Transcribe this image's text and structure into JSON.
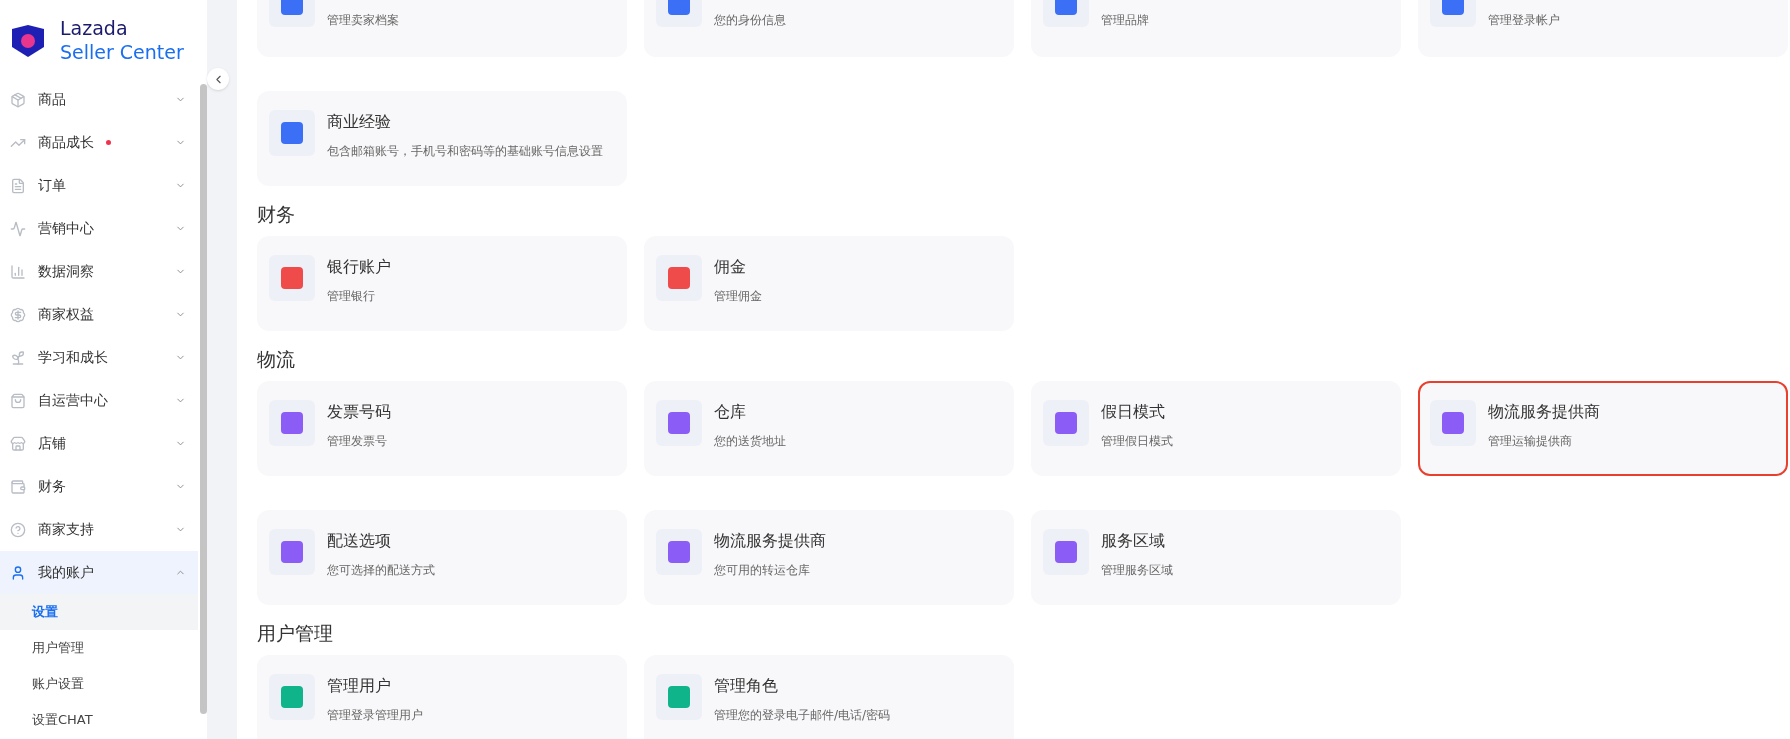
{
  "logo": {
    "line1": "Lazada",
    "line2": "Seller Center"
  },
  "sidebar": {
    "items": [
      {
        "label": "商品",
        "dot": false,
        "expanded": false,
        "selected": false
      },
      {
        "label": "商品成长",
        "dot": true,
        "expanded": false,
        "selected": false
      },
      {
        "label": "订单",
        "dot": false,
        "expanded": false,
        "selected": false
      },
      {
        "label": "营销中心",
        "dot": false,
        "expanded": false,
        "selected": false
      },
      {
        "label": "数据洞察",
        "dot": false,
        "expanded": false,
        "selected": false
      },
      {
        "label": "商家权益",
        "dot": false,
        "expanded": false,
        "selected": false
      },
      {
        "label": "学习和成长",
        "dot": false,
        "expanded": false,
        "selected": false
      },
      {
        "label": "自运营中心",
        "dot": false,
        "expanded": false,
        "selected": false
      },
      {
        "label": "店铺",
        "dot": false,
        "expanded": false,
        "selected": false
      },
      {
        "label": "财务",
        "dot": false,
        "expanded": false,
        "selected": false
      },
      {
        "label": "商家支持",
        "dot": false,
        "expanded": false,
        "selected": false
      },
      {
        "label": "我的账户",
        "dot": false,
        "expanded": true,
        "selected": true,
        "children": [
          {
            "label": "设置",
            "selected": true
          },
          {
            "label": "用户管理",
            "selected": false
          },
          {
            "label": "账户设置",
            "selected": false
          },
          {
            "label": "设置CHAT",
            "selected": false
          }
        ]
      }
    ]
  },
  "sections": [
    {
      "rows": [
        [
          {
            "description": "管理卖家档案",
            "color": "#3b6ff5",
            "highlighted": false
          },
          {
            "description": "您的身份信息",
            "color": "#3b6ff5",
            "highlighted": false
          },
          {
            "description": "管理品牌",
            "color": "#3b6ff5",
            "highlighted": false
          },
          {
            "description": "管理登录帐户",
            "color": "#3b6ff5",
            "highlighted": false
          }
        ],
        [
          {
            "title": "商业经验",
            "description": "包含邮箱账号，手机号和密码等的基础账号信息设置",
            "color": "#3b6ff5",
            "highlighted": false
          }
        ]
      ]
    },
    {
      "title": "财务",
      "rows": [
        [
          {
            "title": "银行账户",
            "description": "管理银行",
            "color": "#f04b4b",
            "highlighted": false
          },
          {
            "title": "佣金",
            "description": "管理佣金",
            "color": "#f04b4b",
            "highlighted": false
          }
        ]
      ]
    },
    {
      "title": "物流",
      "rows": [
        [
          {
            "title": "发票号码",
            "description": "管理发票号",
            "color": "#8b5cf6",
            "highlighted": false
          },
          {
            "title": "仓库",
            "description": "您的送货地址",
            "color": "#8b5cf6",
            "highlighted": false
          },
          {
            "title": "假日模式",
            "description": "管理假日模式",
            "color": "#8b5cf6",
            "highlighted": false
          },
          {
            "title": "物流服务提供商",
            "description": "管理运输提供商",
            "color": "#8b5cf6",
            "highlighted": true
          }
        ],
        [
          {
            "title": "配送选项",
            "description": "您可选择的配送方式",
            "color": "#8b5cf6",
            "highlighted": false
          },
          {
            "title": "物流服务提供商",
            "description": "您可用的转运仓库",
            "color": "#8b5cf6",
            "highlighted": false
          },
          {
            "title": "服务区域",
            "description": "管理服务区域",
            "color": "#8b5cf6",
            "highlighted": false
          }
        ]
      ]
    },
    {
      "title": "用户管理",
      "rows": [
        [
          {
            "title": "管理用户",
            "description": "管理登录管理用户",
            "color": "#10b48a",
            "highlighted": false
          },
          {
            "title": "管理角色",
            "description": "管理您的登录电子邮件/电话/密码",
            "color": "#10b48a",
            "highlighted": false
          }
        ]
      ]
    }
  ]
}
